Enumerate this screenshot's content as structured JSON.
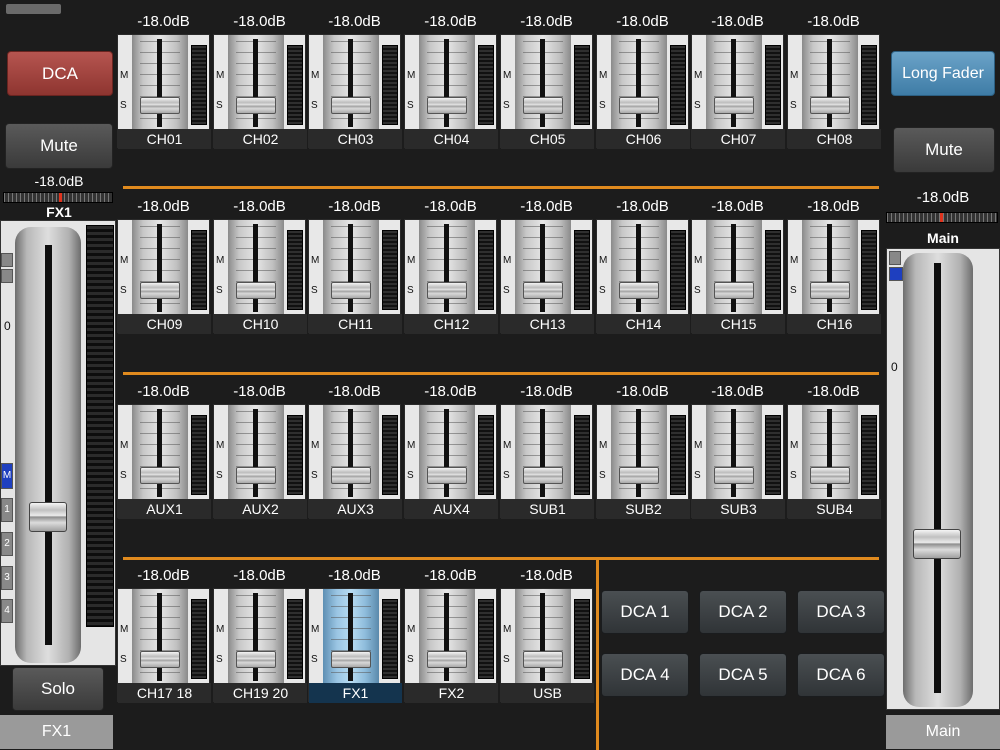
{
  "left_panel": {
    "dca_label": "DCA",
    "mute_label": "Mute",
    "gain": "-18.0dB",
    "fader_title": "FX1",
    "scale_zero": "0",
    "tabs": [
      "M",
      "1",
      "2",
      "3",
      "4"
    ],
    "solo_label": "Solo",
    "footer": "FX1"
  },
  "right_panel": {
    "long_fader_label": "Long Fader",
    "mute_label": "Mute",
    "gain": "-18.0dB",
    "fader_title": "Main",
    "scale_zero": "0",
    "footer": "Main"
  },
  "strip_mute_letter": "M",
  "strip_solo_letter": "S",
  "rows": [
    {
      "strips": [
        {
          "db": "-18.0dB",
          "name": "CH01"
        },
        {
          "db": "-18.0dB",
          "name": "CH02"
        },
        {
          "db": "-18.0dB",
          "name": "CH03"
        },
        {
          "db": "-18.0dB",
          "name": "CH04"
        },
        {
          "db": "-18.0dB",
          "name": "CH05"
        },
        {
          "db": "-18.0dB",
          "name": "CH06"
        },
        {
          "db": "-18.0dB",
          "name": "CH07"
        },
        {
          "db": "-18.0dB",
          "name": "CH08"
        }
      ]
    },
    {
      "strips": [
        {
          "db": "-18.0dB",
          "name": "CH09"
        },
        {
          "db": "-18.0dB",
          "name": "CH10"
        },
        {
          "db": "-18.0dB",
          "name": "CH11"
        },
        {
          "db": "-18.0dB",
          "name": "CH12"
        },
        {
          "db": "-18.0dB",
          "name": "CH13"
        },
        {
          "db": "-18.0dB",
          "name": "CH14"
        },
        {
          "db": "-18.0dB",
          "name": "CH15"
        },
        {
          "db": "-18.0dB",
          "name": "CH16"
        }
      ]
    },
    {
      "strips": [
        {
          "db": "-18.0dB",
          "name": "AUX1"
        },
        {
          "db": "-18.0dB",
          "name": "AUX2"
        },
        {
          "db": "-18.0dB",
          "name": "AUX3"
        },
        {
          "db": "-18.0dB",
          "name": "AUX4"
        },
        {
          "db": "-18.0dB",
          "name": "SUB1"
        },
        {
          "db": "-18.0dB",
          "name": "SUB2"
        },
        {
          "db": "-18.0dB",
          "name": "SUB3"
        },
        {
          "db": "-18.0dB",
          "name": "SUB4"
        }
      ]
    },
    {
      "strips": [
        {
          "db": "-18.0dB",
          "name": "CH17 18"
        },
        {
          "db": "-18.0dB",
          "name": "CH19  20"
        },
        {
          "db": "-18.0dB",
          "name": "FX1",
          "selected": true
        },
        {
          "db": "-18.0dB",
          "name": "FX2"
        },
        {
          "db": "-18.0dB",
          "name": "USB"
        }
      ]
    }
  ],
  "dca_buttons": [
    "DCA 1",
    "DCA 2",
    "DCA 3",
    "DCA 4",
    "DCA 5",
    "DCA 6"
  ],
  "colors": {
    "accent_separator": "#e08a1e",
    "dca_button": "#b65550",
    "long_fader_button": "#6ba3c8",
    "selected_strip": "#9ac5e3",
    "active_tab": "#1e3fbf"
  }
}
